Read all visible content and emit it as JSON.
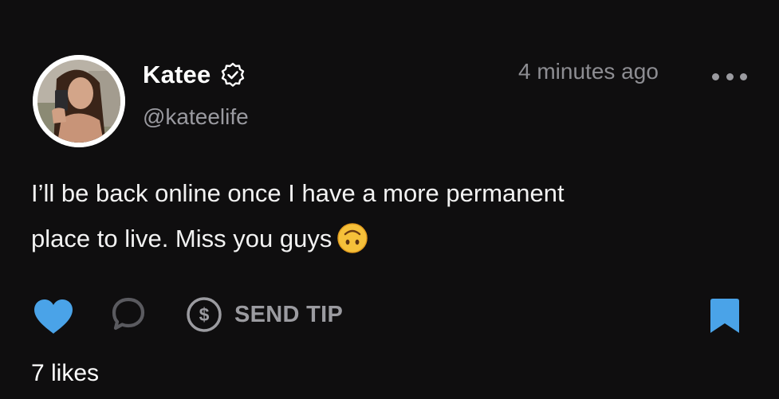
{
  "post": {
    "author": {
      "display_name": "Katee",
      "handle": "@kateelife",
      "verified": true,
      "avatar": "avatar-photo"
    },
    "timestamp": "4 minutes ago",
    "text_line1": "I’ll be back online once I have a more permanent",
    "text_line2": "place to live. Miss you guys",
    "emoji": "upside-down-face",
    "actions": {
      "like": "heart-icon",
      "comment": "comment-icon",
      "tip_label": "SEND TIP",
      "tip_icon": "dollar-circle-icon",
      "bookmark": "bookmark-icon"
    },
    "likes_text": "7 likes",
    "liked": true,
    "bookmarked": true
  },
  "colors": {
    "background": "#0f0e0f",
    "accent": "#4aa3e8",
    "muted": "#9b9ba0",
    "text": "#ffffff"
  }
}
